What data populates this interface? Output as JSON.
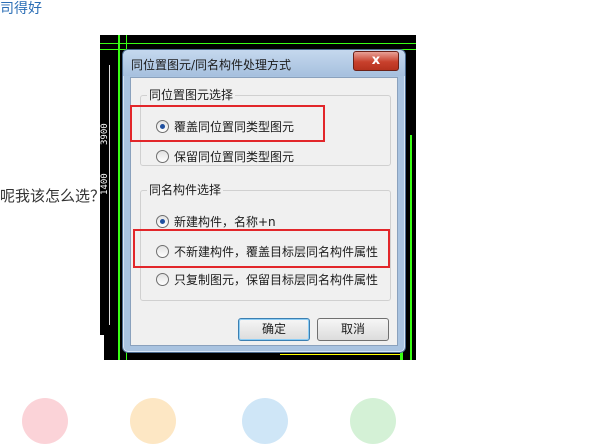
{
  "page": {
    "top_text": "司得好",
    "mid_text": "呢我该怎么选？"
  },
  "cad": {
    "ruler_labels": [
      "3900",
      "1400"
    ]
  },
  "dialog": {
    "title": "同位置图元/同名构件处理方式",
    "close_label": "x",
    "group1": {
      "legend": "同位置图元选择",
      "options": [
        {
          "label": "覆盖同位置同类型图元",
          "checked": true
        },
        {
          "label": "保留同位置同类型图元",
          "checked": false
        }
      ]
    },
    "group2": {
      "legend": "同名构件选择",
      "options": [
        {
          "label": "新建构件，名称+n",
          "checked": true
        },
        {
          "label": "不新建构件，覆盖目标层同名构件属性",
          "checked": false
        },
        {
          "label": "只复制图元，保留目标层同名构件属性",
          "checked": false
        }
      ]
    },
    "ok_label": "确定",
    "cancel_label": "取消"
  },
  "colors": {
    "highlight_box": "#e2262a",
    "link_text": "#2a6db5",
    "cad_background": "#000000",
    "cad_green": "#39ff14",
    "cad_magenta": "#ff00ff",
    "cad_yellow": "#ffff00"
  }
}
